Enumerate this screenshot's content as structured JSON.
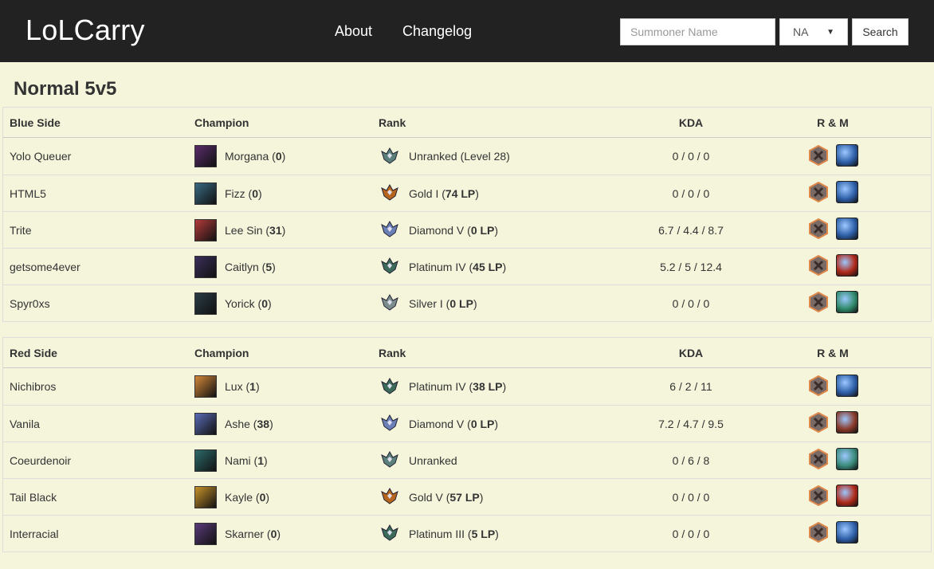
{
  "app": {
    "brand": "LoLCarry"
  },
  "nav": {
    "about": "About",
    "changelog": "Changelog"
  },
  "search": {
    "placeholder": "Summoner Name",
    "region": "NA",
    "button": "Search"
  },
  "page_title": "Normal 5v5",
  "columns": {
    "champion": "Champion",
    "rank": "Rank",
    "kda": "KDA",
    "rm": "R & M"
  },
  "colors": {
    "navbar": "#222222",
    "background": "#f5f5dc"
  },
  "teams": [
    {
      "label": "Blue Side",
      "players": [
        {
          "name": "Yolo Queuer",
          "champion": "Morgana",
          "champ_games": "0",
          "rank": "Unranked (Level 28)",
          "lp": "",
          "kda": "0 / 0 / 0",
          "champ_color": "#5a2c6b",
          "rank_color": "#5b7f7a",
          "mastery_color": "#2e5fa8"
        },
        {
          "name": "HTML5",
          "champion": "Fizz",
          "champ_games": "0",
          "rank": "Gold I",
          "lp": "74 LP",
          "kda": "0 / 0 / 0",
          "champ_color": "#3a6b82",
          "rank_color": "#b5651d",
          "mastery_color": "#2e5fa8"
        },
        {
          "name": "Trite",
          "champion": "Lee Sin",
          "champ_games": "31",
          "rank": "Diamond V",
          "lp": "0 LP",
          "kda": "6.7 / 4.4 / 8.7",
          "champ_color": "#b33a3a",
          "rank_color": "#6a7fb5",
          "mastery_color": "#2e5fa8"
        },
        {
          "name": "getsome4ever",
          "champion": "Caitlyn",
          "champ_games": "5",
          "rank": "Platinum IV",
          "lp": "45 LP",
          "kda": "5.2 / 5 / 12.4",
          "champ_color": "#3b2f5b",
          "rank_color": "#3c6b5a",
          "mastery_color": "#b02a1a"
        },
        {
          "name": "Spyr0xs",
          "champion": "Yorick",
          "champ_games": "0",
          "rank": "Silver I",
          "lp": "0 LP",
          "kda": "0 / 0 / 0",
          "champ_color": "#2a3d45",
          "rank_color": "#7d8c8c",
          "mastery_color": "#2f8a6a"
        }
      ]
    },
    {
      "label": "Red Side",
      "players": [
        {
          "name": "Nichibros",
          "champion": "Lux",
          "champ_games": "1",
          "rank": "Platinum IV",
          "lp": "38 LP",
          "kda": "6 / 2 / 11",
          "champ_color": "#d4883a",
          "rank_color": "#3c6b5a",
          "mastery_color": "#2e5fa8"
        },
        {
          "name": "Vanila",
          "champion": "Ashe",
          "champ_games": "38",
          "rank": "Diamond V",
          "lp": "0 LP",
          "kda": "7.2 / 4.7 / 9.5",
          "champ_color": "#5a6bb5",
          "rank_color": "#6a7fb5",
          "mastery_color": "#8a3a2a"
        },
        {
          "name": "Coeurdenoir",
          "champion": "Nami",
          "champ_games": "1",
          "rank": "Unranked",
          "lp": "",
          "kda": "0 / 6 / 8",
          "champ_color": "#2e6b6b",
          "rank_color": "#5b7f7a",
          "mastery_color": "#3a8a7a"
        },
        {
          "name": "Tail Black",
          "champion": "Kayle",
          "champ_games": "0",
          "rank": "Gold V",
          "lp": "57 LP",
          "kda": "0 / 0 / 0",
          "champ_color": "#c8932a",
          "rank_color": "#b5651d",
          "mastery_color": "#b02a1a"
        },
        {
          "name": "Interracial",
          "champion": "Skarner",
          "champ_games": "0",
          "rank": "Platinum III",
          "lp": "5 LP",
          "kda": "0 / 0 / 0",
          "champ_color": "#5a3a7a",
          "rank_color": "#3c6b5a",
          "mastery_color": "#2e5fa8"
        }
      ]
    }
  ]
}
